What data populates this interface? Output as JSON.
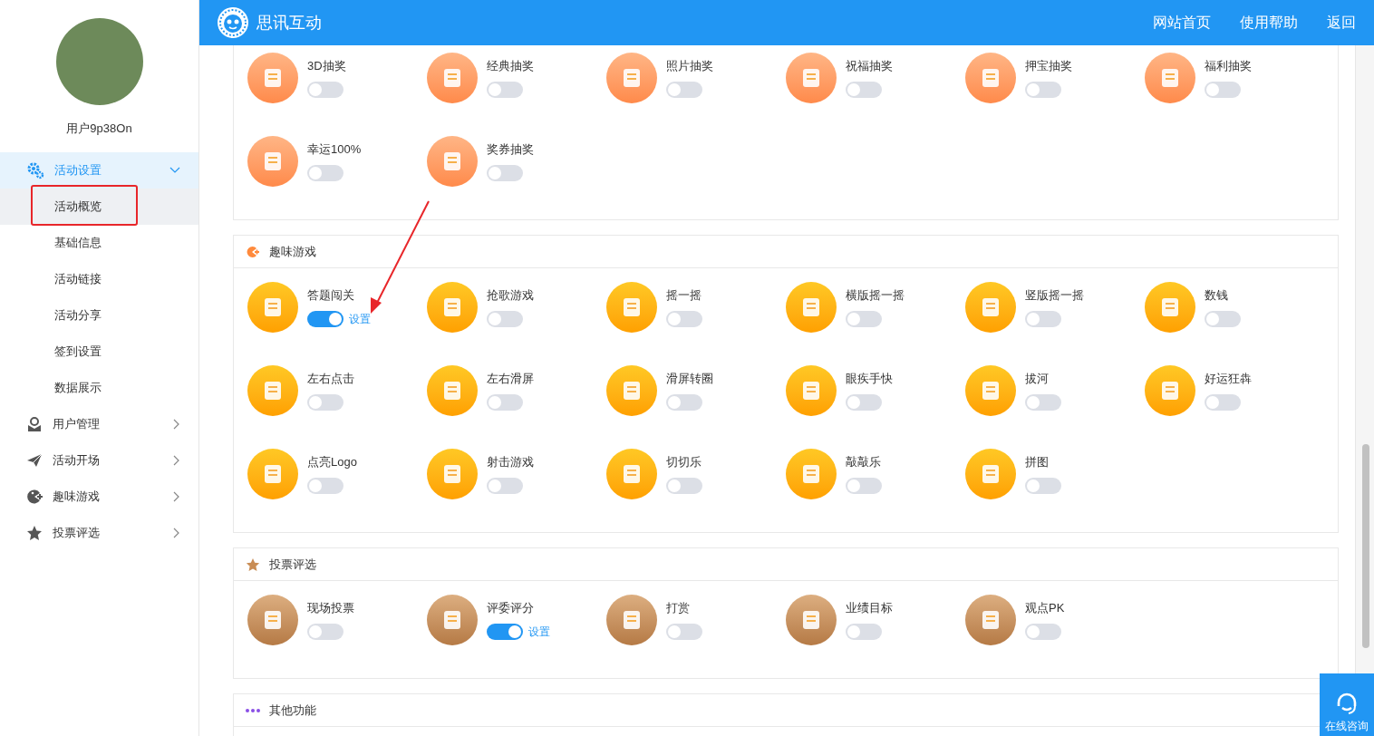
{
  "header": {
    "brand": "思讯互动",
    "links": [
      "网站首页",
      "使用帮助",
      "返回"
    ]
  },
  "sidebar": {
    "user_name": "用户9p38On",
    "menu": [
      {
        "label": "活动设置",
        "selected": true,
        "expanded": true,
        "children": [
          {
            "label": "活动概览",
            "selected": true
          },
          {
            "label": "基础信息",
            "selected": false
          },
          {
            "label": "活动链接",
            "selected": false
          },
          {
            "label": "活动分享",
            "selected": false
          },
          {
            "label": "签到设置",
            "selected": false
          },
          {
            "label": "数据展示",
            "selected": false
          }
        ]
      },
      {
        "label": "用户管理",
        "selected": false,
        "expanded": false
      },
      {
        "label": "活动开场",
        "selected": false,
        "expanded": false
      },
      {
        "label": "趣味游戏",
        "selected": false,
        "expanded": false
      },
      {
        "label": "投票评选",
        "selected": false,
        "expanded": false
      }
    ]
  },
  "sections": [
    {
      "kind": "lottery",
      "items": [
        {
          "label": "3D抽奖",
          "on": false
        },
        {
          "label": "经典抽奖",
          "on": false
        },
        {
          "label": "照片抽奖",
          "on": false
        },
        {
          "label": "祝福抽奖",
          "on": false
        },
        {
          "label": "押宝抽奖",
          "on": false
        },
        {
          "label": "福利抽奖",
          "on": false
        },
        {
          "label": "幸运100%",
          "on": false
        },
        {
          "label": "奖券抽奖",
          "on": false
        }
      ]
    },
    {
      "kind": "game",
      "title": "趣味游戏",
      "items": [
        {
          "label": "答题闯关",
          "on": true,
          "settings_link": "设置"
        },
        {
          "label": "抢歌游戏",
          "on": false
        },
        {
          "label": "摇一摇",
          "on": false
        },
        {
          "label": "横版摇一摇",
          "on": false
        },
        {
          "label": "竖版摇一摇",
          "on": false
        },
        {
          "label": "数钱",
          "on": false
        },
        {
          "label": "左右点击",
          "on": false
        },
        {
          "label": "左右滑屏",
          "on": false
        },
        {
          "label": "滑屏转圈",
          "on": false
        },
        {
          "label": "眼疾手快",
          "on": false
        },
        {
          "label": "拔河",
          "on": false
        },
        {
          "label": "好运狂犇",
          "on": false
        },
        {
          "label": "点亮Logo",
          "on": false
        },
        {
          "label": "射击游戏",
          "on": false
        },
        {
          "label": "切切乐",
          "on": false
        },
        {
          "label": "敲敲乐",
          "on": false
        },
        {
          "label": "拼图",
          "on": false
        }
      ]
    },
    {
      "kind": "vote",
      "title": "投票评选",
      "items": [
        {
          "label": "现场投票",
          "on": false
        },
        {
          "label": "评委评分",
          "on": true,
          "settings_link": "设置"
        },
        {
          "label": "打赏",
          "on": false
        },
        {
          "label": "业绩目标",
          "on": false
        },
        {
          "label": "观点PK",
          "on": false
        }
      ]
    },
    {
      "kind": "other",
      "title": "其他功能"
    }
  ],
  "float_button": {
    "label": "在线咨询"
  }
}
